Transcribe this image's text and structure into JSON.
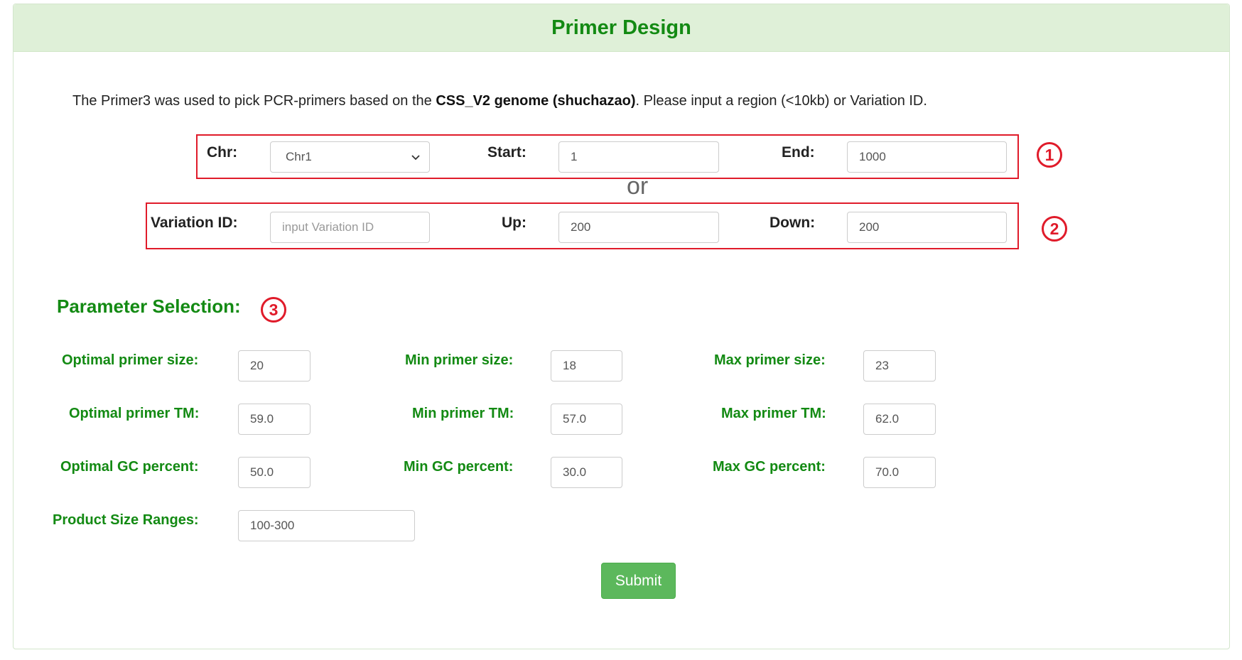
{
  "panel": {
    "title": "Primer Design"
  },
  "intro": {
    "prefix": "The Primer3 was used to pick PCR-primers based on the ",
    "genome": "CSS_V2 genome (shuchazao)",
    "suffix": ". Please input a region (<10kb) or Variation ID."
  },
  "region": {
    "chr_label": "Chr:",
    "chr_value": "Chr1",
    "start_label": "Start:",
    "start_value": "1",
    "end_label": "End:",
    "end_value": "1000"
  },
  "or_text": "or",
  "variation": {
    "id_label": "Variation ID:",
    "id_placeholder": "input Variation ID",
    "up_label": "Up:",
    "up_value": "200",
    "down_label": "Down:",
    "down_value": "200"
  },
  "markers": {
    "one": "1",
    "two": "2",
    "three": "3",
    "color": "#e01b2a"
  },
  "params": {
    "title": "Parameter Selection:",
    "optimal_size_label": "Optimal primer size:",
    "optimal_size_value": "20",
    "min_size_label": "Min primer size:",
    "min_size_value": "18",
    "max_size_label": "Max primer size:",
    "max_size_value": "23",
    "optimal_tm_label": "Optimal primer TM:",
    "optimal_tm_value": "59.0",
    "min_tm_label": "Min primer TM:",
    "min_tm_value": "57.0",
    "max_tm_label": "Max primer TM:",
    "max_tm_value": "62.0",
    "optimal_gc_label": "Optimal GC percent:",
    "optimal_gc_value": "50.0",
    "min_gc_label": "Min GC percent:",
    "min_gc_value": "30.0",
    "max_gc_label": "Max GC percent:",
    "max_gc_value": "70.0",
    "product_label": "Product Size Ranges:",
    "product_value": "100-300"
  },
  "submit_label": "Submit",
  "colors": {
    "heading_bg": "#dff0d8",
    "heading_text": "#138a13",
    "submit_bg": "#5cb85c"
  }
}
